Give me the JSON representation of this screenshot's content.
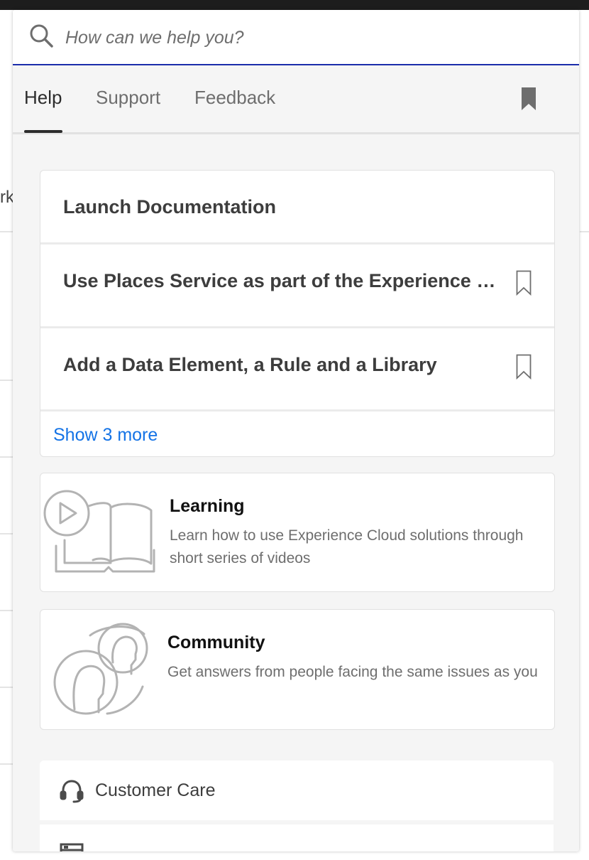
{
  "background": {
    "fragment_text": "rk"
  },
  "search": {
    "placeholder": "How can we help you?"
  },
  "tabs": [
    {
      "label": "Help",
      "active": true
    },
    {
      "label": "Support",
      "active": false
    },
    {
      "label": "Feedback",
      "active": false
    }
  ],
  "documentation": {
    "title": "Launch Documentation",
    "items": [
      {
        "label": "Use Places Service as part of the Experience Platform Launch Extension"
      },
      {
        "label": "Add a Data Element, a Rule and a Library"
      }
    ],
    "show_more_label": "Show 3 more"
  },
  "learning": {
    "title": "Learning",
    "description_line1": "Learn how to use Experience Cloud solutions through",
    "description_line2": "short series of videos"
  },
  "community": {
    "title": "Community",
    "description": "Get answers from people facing the same issues as you"
  },
  "links": [
    {
      "label": "Customer Care",
      "icon": "headset-icon"
    },
    {
      "label": "",
      "icon": "status-icon"
    }
  ],
  "colors": {
    "accent_link": "#1473e6",
    "search_focus_border": "#1b2dab",
    "panel_background": "#f5f5f5"
  }
}
